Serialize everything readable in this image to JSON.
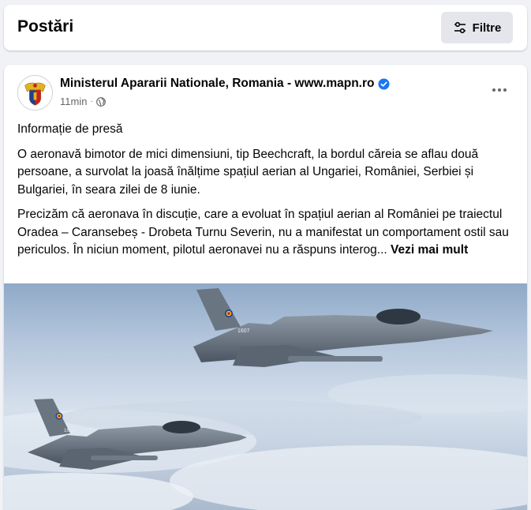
{
  "header": {
    "title": "Postări",
    "filter_label": "Filtre"
  },
  "post": {
    "author": "Ministerul Apararii Nationale, Romania - www.mapn.ro",
    "time": "11min",
    "separator": "·",
    "paragraphs": [
      "Informație de presă",
      "O aeronavă bimotor de mici dimensiuni, tip Beechcraft, la bordul căreia se aflau două persoane, a survolat la joasă înălțime spațiul aerian al Ungariei, României, Serbiei și Bulgariei, în seara zilei de 8 iunie."
    ],
    "truncated_paragraph": "Precizăm că aeronava în discuție, care a evoluat în spațiul aerian al României pe traiectul Oradea – Caransebeș - Drobeta Turnu Severin, nu a manifestat un comportament ostil sau periculos. În niciun moment, pilotul aeronavei nu a răspuns interog...",
    "see_more_label": "Vezi mai mult",
    "image_tail_numbers": [
      "1607",
      "1615"
    ]
  },
  "colors": {
    "background": "#f0f2f5",
    "card": "#ffffff",
    "button_bg": "#e4e6eb",
    "secondary_text": "#65676b",
    "verified": "#1877f2"
  }
}
